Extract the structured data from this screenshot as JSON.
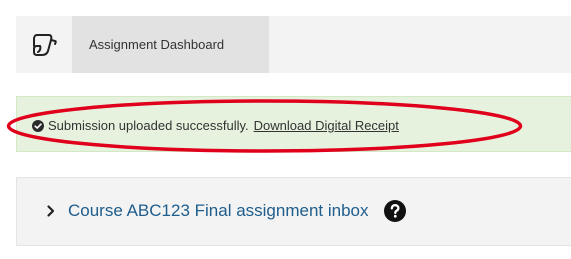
{
  "header": {
    "logo_icon": "scroll-logo-icon",
    "active_tab_label": "Assignment Dashboard"
  },
  "alert": {
    "status": "success",
    "icon": "check-circle-icon",
    "message": "Submission uploaded successfully.",
    "link_label": "Download Digital Receipt",
    "annotation_color": "#e0001b"
  },
  "panel": {
    "toggle_icon": "chevron-right-icon",
    "title": "Course ABC123 Final assignment inbox",
    "help_icon": "question-circle-icon"
  },
  "colors": {
    "success_bg": "#e6f2de",
    "link": "#1e5d8c",
    "nav_bg": "#f3f3f3"
  }
}
